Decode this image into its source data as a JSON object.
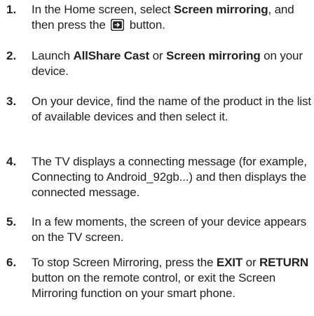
{
  "steps": [
    {
      "number": "1.",
      "parts": [
        "In the Home screen, select ",
        "Screen mirroring",
        ", and then press the ",
        " button."
      ]
    },
    {
      "number": "2.",
      "parts": [
        "Launch ",
        "AllShare Cast",
        " or ",
        "Screen mirroring",
        " on your device."
      ]
    },
    {
      "number": "3.",
      "text": "On your device, find the name of the product in the list of available devices and then select it."
    },
    {
      "number": "4.",
      "text": "The TV displays a connecting message (for example, Connecting to Android_92gb...) and then displays the connected message."
    },
    {
      "number": "5.",
      "text": "In a few moments, the screen of your device appears on the TV screen."
    },
    {
      "number": "6.",
      "parts": [
        "To stop Screen Mirroring, press the ",
        "EXIT",
        " or ",
        "RETURN",
        " button on the remote control, or exit the Screen Mirroring function on your smart phone."
      ]
    }
  ],
  "icons": {
    "source_button": "source-button-icon"
  }
}
